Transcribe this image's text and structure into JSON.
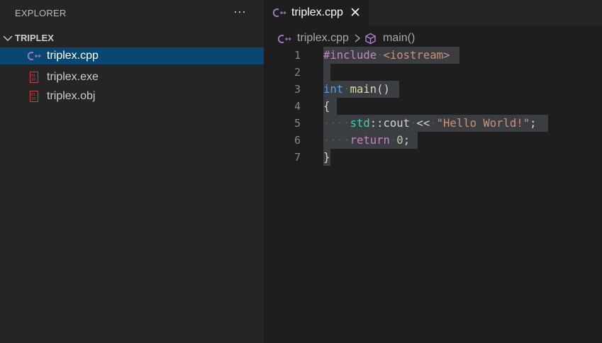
{
  "explorer": {
    "title": "EXPLORER",
    "more_icon": "ellipsis-icon",
    "folder": {
      "name": "TRIPLEX",
      "expanded": true
    },
    "files": [
      {
        "name": "triplex.cpp",
        "icon": "cpp-file-icon",
        "selected": true
      },
      {
        "name": "triplex.exe",
        "icon": "binary-file-icon",
        "selected": false
      },
      {
        "name": "triplex.obj",
        "icon": "binary-file-icon",
        "selected": false
      }
    ]
  },
  "editor": {
    "tab": {
      "label": "triplex.cpp",
      "icon": "cpp-file-icon",
      "close_icon": "close-icon"
    },
    "breadcrumb": {
      "file": "triplex.cpp",
      "symbol": "main()",
      "symbol_icon": "symbol-method-icon"
    },
    "line_numbers": [
      "1",
      "2",
      "3",
      "4",
      "5",
      "6",
      "7"
    ],
    "code": {
      "l1": {
        "directive": "#include",
        "header": "<iostream>"
      },
      "l3": {
        "type": "int",
        "name": "main",
        "parens": "()"
      },
      "l4": {
        "brace": "{"
      },
      "l5": {
        "ns": "std",
        "scope": "::",
        "ident": "cout",
        "op": "<<",
        "str": "\"Hello World!\"",
        "semi": ";"
      },
      "l6": {
        "kw": "return",
        "num": "0",
        "semi": ";"
      },
      "l7": {
        "brace": "}"
      }
    }
  },
  "colors": {
    "sidebar_bg": "#252526",
    "editor_bg": "#1e1e1e",
    "selected_row": "#094771",
    "selection": "#3a3d41",
    "cpp_icon": "#a074c4",
    "binary_icon": "#cc3e44"
  }
}
